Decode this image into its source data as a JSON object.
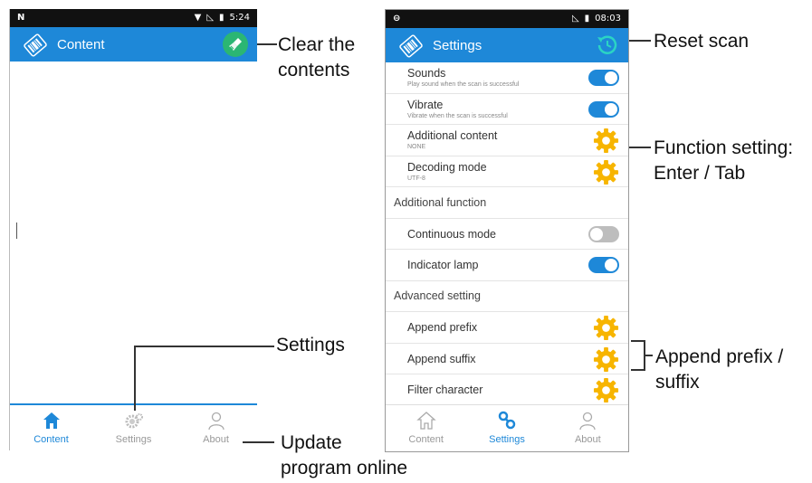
{
  "phone1": {
    "status": {
      "carrier_icon": "N",
      "time": "5:24"
    },
    "appbar": {
      "title": "Content"
    },
    "tabs": [
      {
        "label": "Content",
        "icon": "home-icon",
        "active": true
      },
      {
        "label": "Settings",
        "icon": "gears-icon",
        "active": false
      },
      {
        "label": "About",
        "icon": "person-icon",
        "active": false
      }
    ]
  },
  "phone2": {
    "status": {
      "time": "08:03"
    },
    "appbar": {
      "title": "Settings"
    },
    "rows": {
      "sounds": {
        "label": "Sounds",
        "sub": "Play sound when the scan is successful",
        "on": true
      },
      "vibrate": {
        "label": "Vibrate",
        "sub": "Vibrate when the scan is successful",
        "on": true
      },
      "additional_content": {
        "label": "Additional content",
        "sub": "NONE"
      },
      "decoding_mode": {
        "label": "Decoding mode",
        "sub": "UTF-8"
      },
      "section_additional": "Additional function",
      "continuous_mode": {
        "label": "Continuous mode",
        "on": false
      },
      "indicator_lamp": {
        "label": "Indicator lamp",
        "on": true
      },
      "section_advanced": "Advanced setting",
      "append_prefix": {
        "label": "Append prefix"
      },
      "append_suffix": {
        "label": "Append suffix"
      },
      "filter_character": {
        "label": "Filter character"
      }
    },
    "tabs": [
      {
        "label": "Content",
        "icon": "home-icon",
        "active": false
      },
      {
        "label": "Settings",
        "icon": "settings-link-icon",
        "active": true
      },
      {
        "label": "About",
        "icon": "person-icon",
        "active": false
      }
    ]
  },
  "callouts": {
    "clear_line1": "Clear the",
    "clear_line2": "contents",
    "settings": "Settings",
    "update_line1": "Update",
    "update_line2": "program online",
    "reset": "Reset scan",
    "function_line1": "Function setting:",
    "function_line2": "Enter / Tab",
    "append_line1": "Append prefix /",
    "append_line2": "suffix"
  },
  "colors": {
    "accent": "#1e88d8",
    "clear_button": "#2bb673",
    "gear": "#f7b500"
  }
}
